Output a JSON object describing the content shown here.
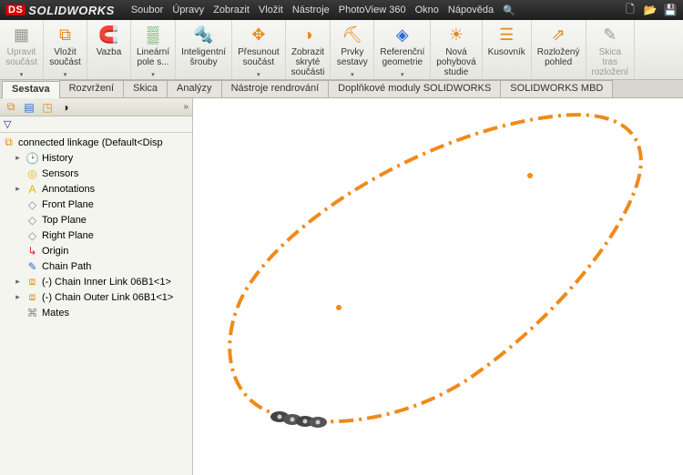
{
  "app": {
    "brand": "SOLIDWORKS"
  },
  "menu": {
    "file": "Soubor",
    "edit": "Úpravy",
    "view": "Zobrazit",
    "insert": "Vložit",
    "tools": "Nástroje",
    "photoview": "PhotoView 360",
    "window": "Okno",
    "help": "Nápověda"
  },
  "ribbon": {
    "edit_component": "Upravit\nsoučást",
    "insert_component": "Vložit\nsoučást",
    "mate": "Vazba",
    "linear_pattern": "Lineární\npole s...",
    "smart_fasteners": "Inteligentní\nšrouby",
    "move_component": "Přesunout\nsoučást",
    "show_hidden": "Zobrazit\nskryté\nsoučásti",
    "assembly_features": "Prvky\nsestavy",
    "ref_geometry": "Referenční\ngeometrie",
    "new_motion": "Nová\npohybová\nstudie",
    "bom": "Kusovník",
    "exploded": "Rozložený\npohled",
    "sketch_exp": "Skica\ntras\nrozložení"
  },
  "tabs": {
    "assembly": "Sestava",
    "layout": "Rozvržení",
    "sketch": "Skica",
    "evaluate": "Analýzy",
    "render": "Nástroje rendrování",
    "addins": "Doplňkové moduly SOLIDWORKS",
    "mbd": "SOLIDWORKS MBD"
  },
  "tree": {
    "root": "connected linkage  (Default<Disp",
    "history": "History",
    "sensors": "Sensors",
    "annotations": "Annotations",
    "front": "Front Plane",
    "top": "Top Plane",
    "right": "Right Plane",
    "origin": "Origin",
    "chainpath": "Chain Path",
    "inner": "(-) Chain Inner Link 06B1<1>",
    "outer": "(-) Chain Outer Link 06B1<1>",
    "mates": "Mates"
  }
}
